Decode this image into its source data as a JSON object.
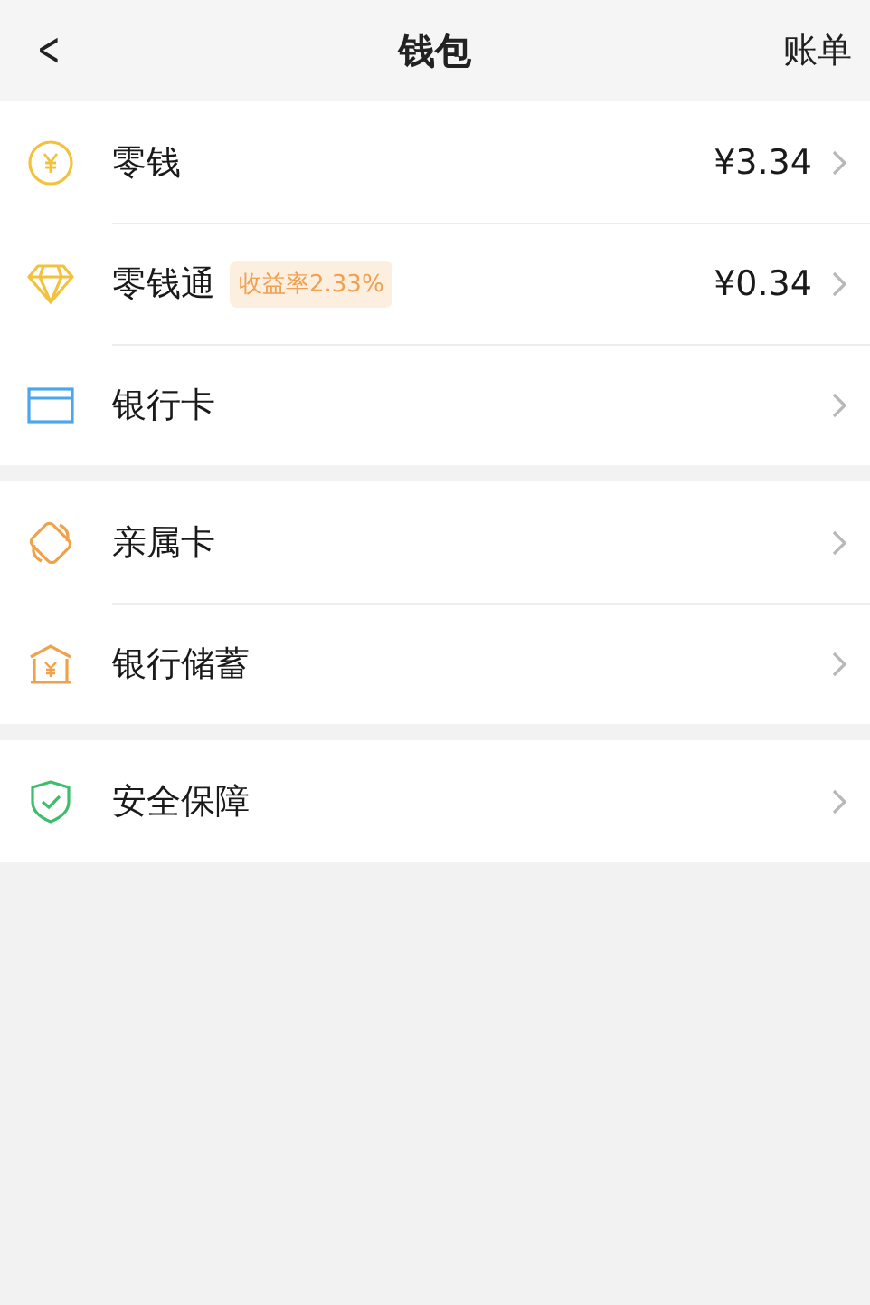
{
  "header": {
    "back": "<",
    "title": "钱包",
    "action": "账单"
  },
  "groups": [
    {
      "items": [
        {
          "kind": "coin",
          "label": "零钱",
          "value": "¥3.34"
        },
        {
          "kind": "diamond",
          "label": "零钱通",
          "badge": "收益率2.33%",
          "value": "¥0.34"
        },
        {
          "kind": "card",
          "label": "银行卡"
        }
      ]
    },
    {
      "items": [
        {
          "kind": "family",
          "label": "亲属卡"
        },
        {
          "kind": "bank",
          "label": "银行储蓄"
        }
      ]
    },
    {
      "items": [
        {
          "kind": "shield",
          "label": "安全保障"
        }
      ]
    }
  ]
}
